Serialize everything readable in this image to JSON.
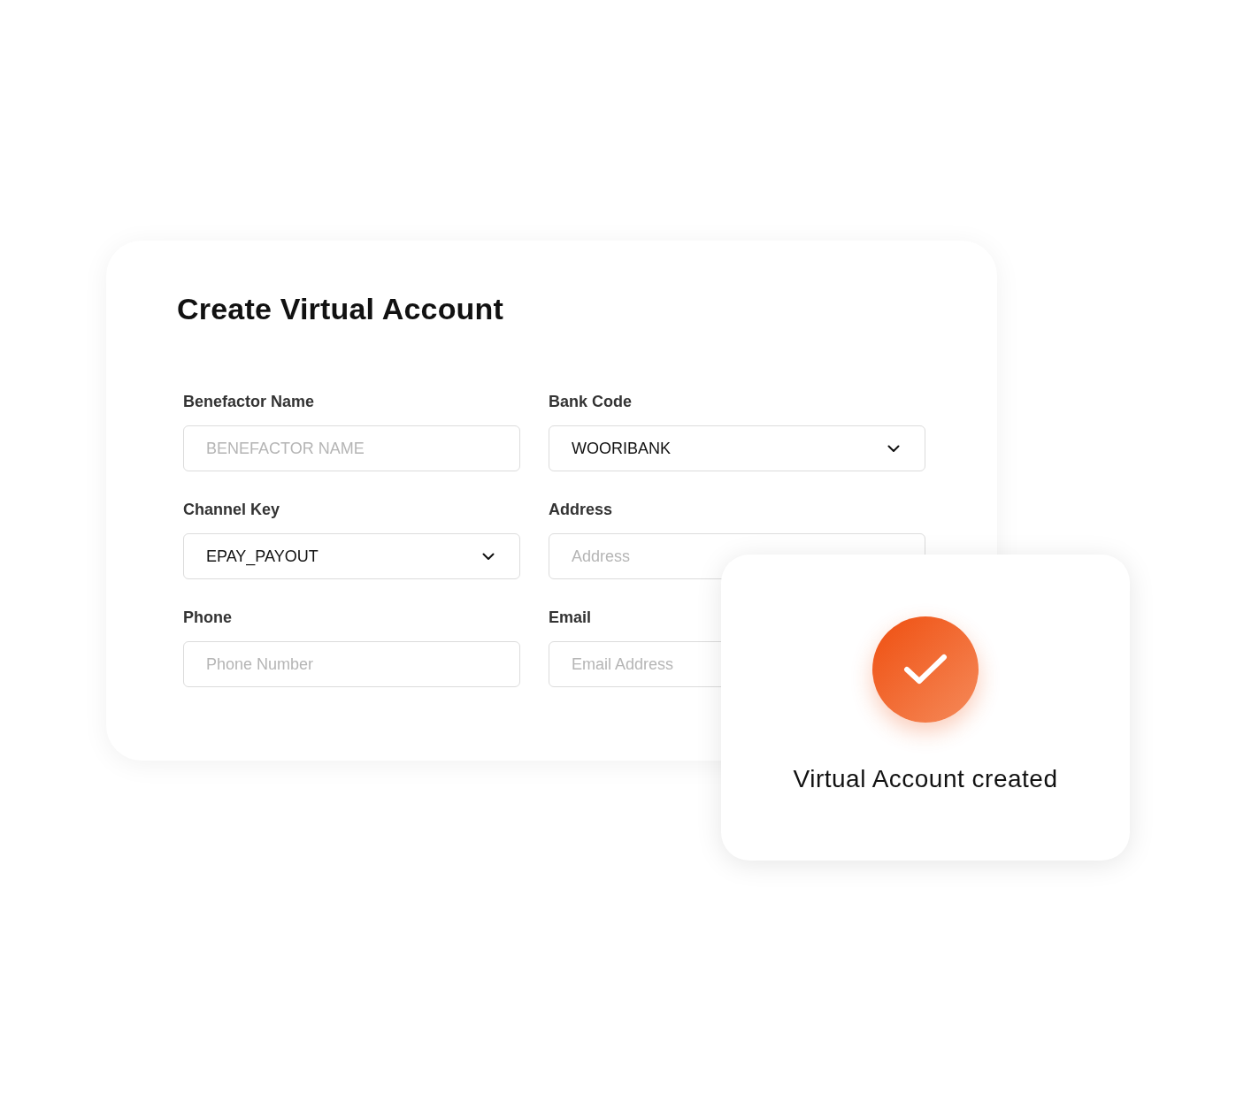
{
  "form": {
    "title": "Create Virtual Account",
    "fields": [
      {
        "label": "Benefactor Name",
        "kind": "text",
        "placeholder": "BENEFACTOR NAME"
      },
      {
        "label": "Bank Code",
        "kind": "select",
        "value": "WOORIBANK"
      },
      {
        "label": "Channel Key",
        "kind": "select",
        "value": "EPAY_PAYOUT"
      },
      {
        "label": "Address",
        "kind": "text",
        "placeholder": "Address"
      },
      {
        "label": "Phone",
        "kind": "text",
        "placeholder": "Phone Number"
      },
      {
        "label": "Email",
        "kind": "text",
        "placeholder": "Email Address"
      }
    ]
  },
  "success_card": {
    "message": "Virtual Account created"
  }
}
